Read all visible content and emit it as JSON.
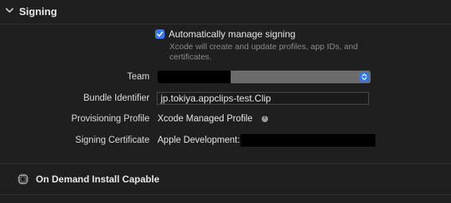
{
  "section": {
    "title": "Signing",
    "icon": "chevron-down-icon"
  },
  "auto_signing": {
    "label": "Automatically manage signing",
    "checked": true,
    "description": "Xcode will create and update profiles, app IDs, and certificates."
  },
  "team": {
    "label": "Team",
    "value_redacted": true
  },
  "bundle_identifier": {
    "label": "Bundle Identifier",
    "value": "jp.tokiya.appclips-test.Clip"
  },
  "provisioning_profile": {
    "label": "Provisioning Profile",
    "value": "Xcode Managed Profile",
    "icon": "info-icon"
  },
  "signing_certificate": {
    "label": "Signing Certificate",
    "value": "Apple Development:"
  },
  "capability": {
    "title": "On Demand Install Capable",
    "icon": "capability-chip-icon"
  },
  "colors": {
    "background": "#1f1f1f",
    "accent": "#3478f6",
    "secondary_text": "#8a8a8a"
  }
}
